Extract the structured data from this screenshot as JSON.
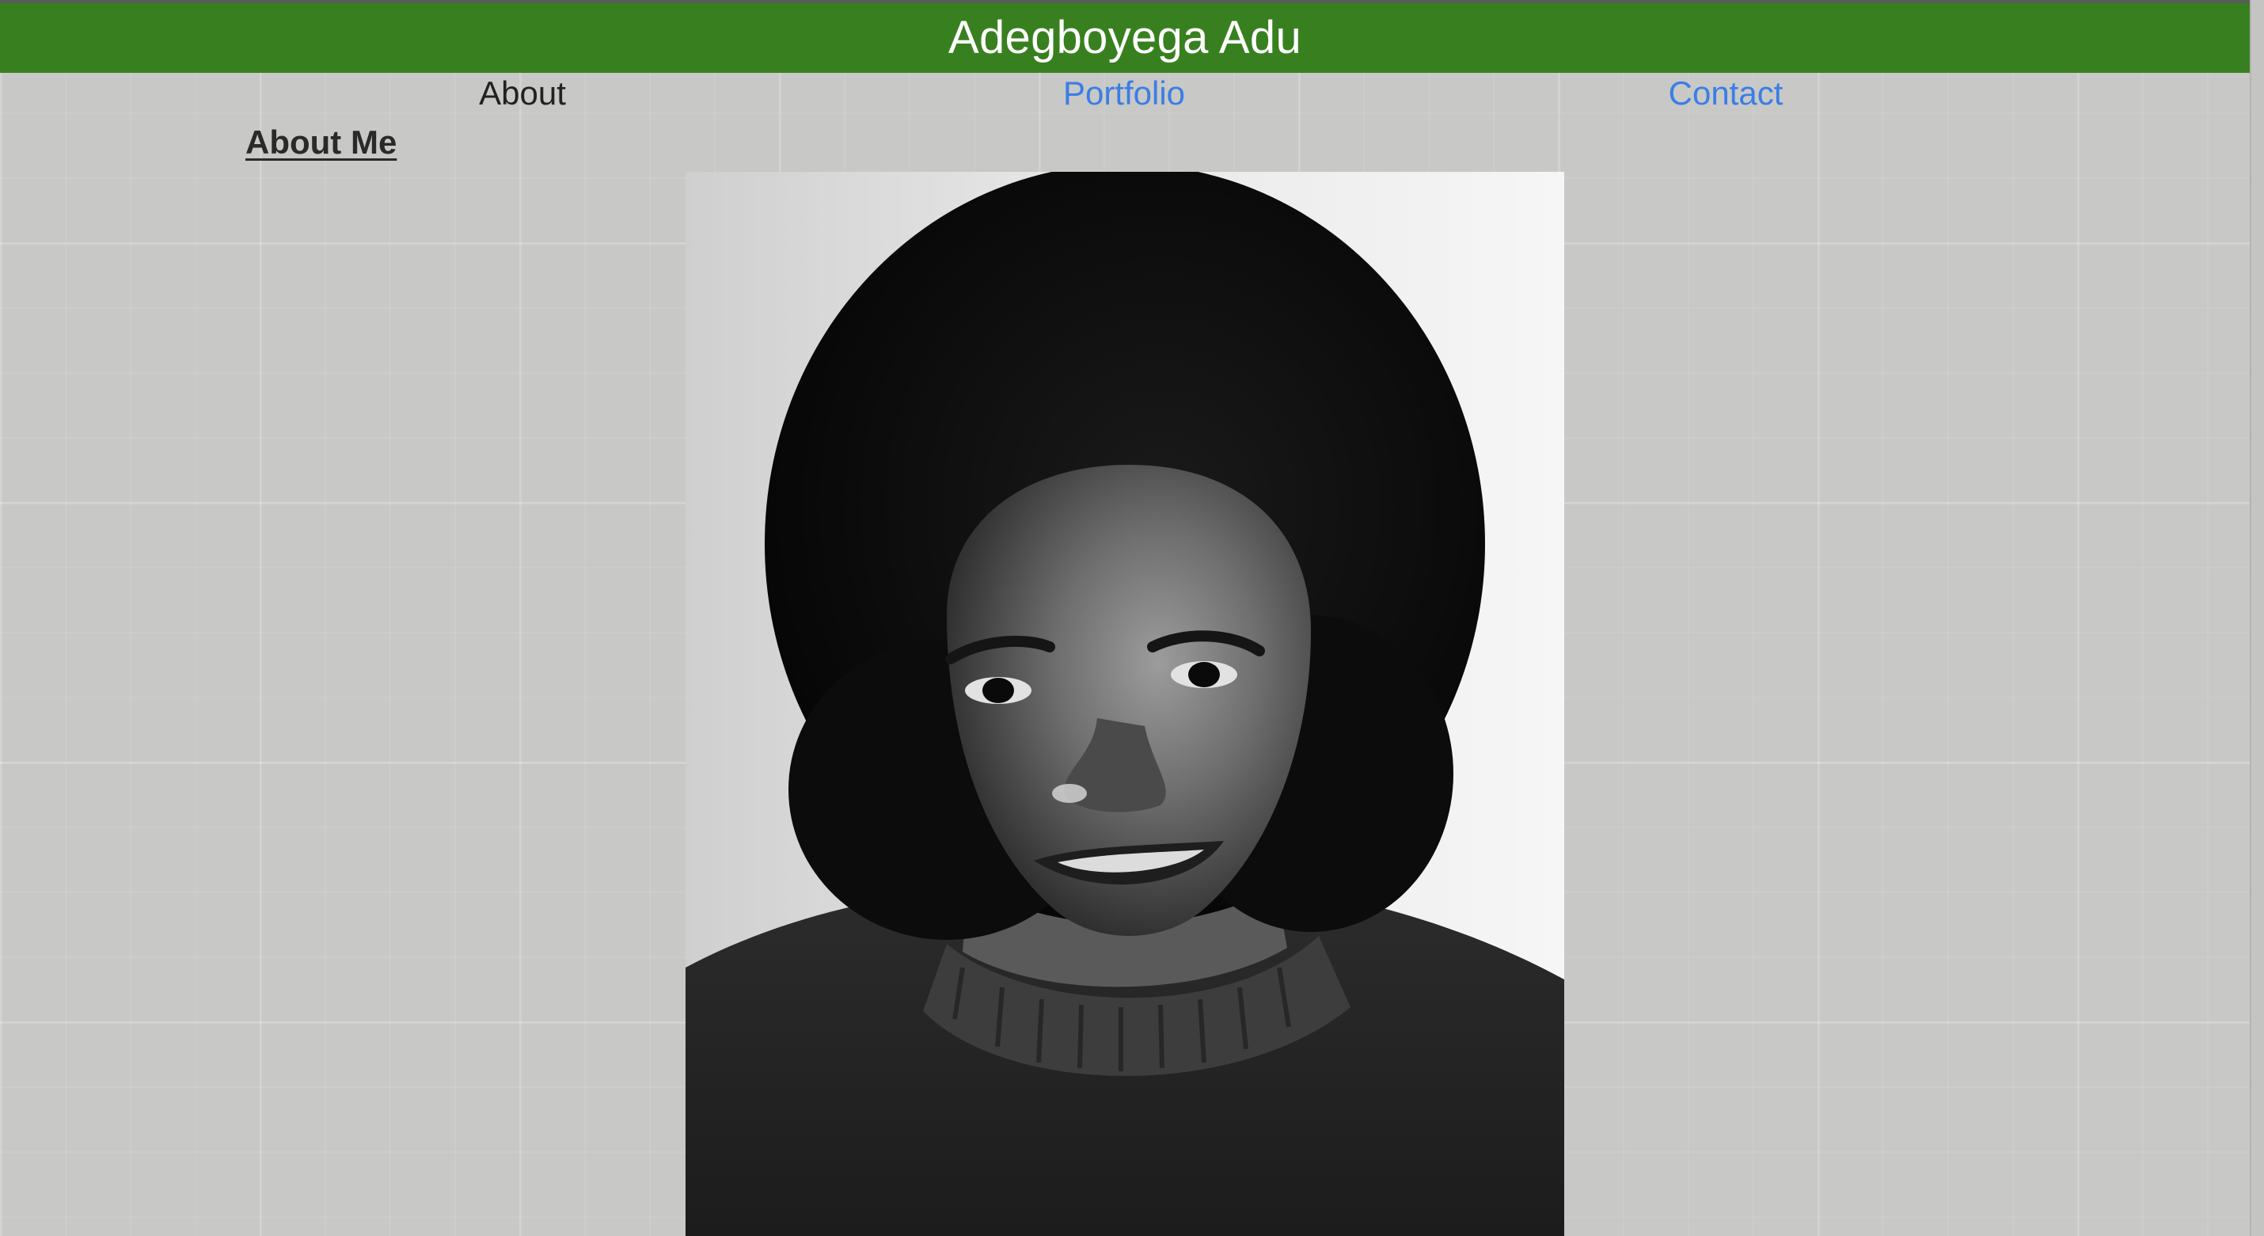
{
  "header": {
    "title": "Adegboyega Adu",
    "background_color": "#38801f"
  },
  "nav": {
    "items": [
      {
        "label": "About",
        "color": "#222222"
      },
      {
        "label": "Portfolio",
        "color": "#3a7ee6"
      },
      {
        "label": "Contact",
        "color": "#3a7ee6"
      }
    ]
  },
  "main": {
    "section_heading": "About Me",
    "portrait_icon": "portrait-photo"
  },
  "colors": {
    "page_background": "#c8c8c6",
    "link": "#3a7ee6"
  }
}
